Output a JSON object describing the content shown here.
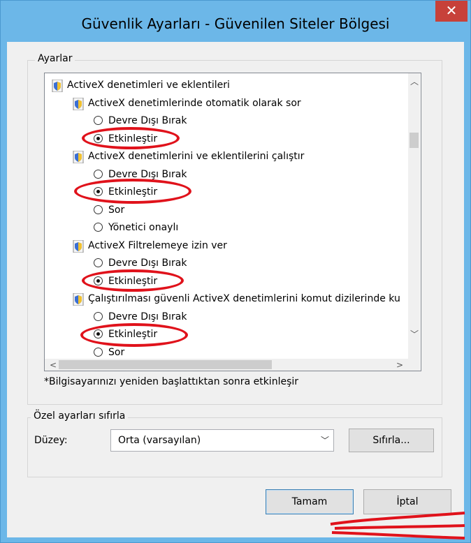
{
  "window": {
    "title": "Güvenlik Ayarları - Güvenilen Siteler Bölgesi",
    "close_glyph": "✕"
  },
  "settings_group": {
    "legend": "Ayarlar",
    "tree": [
      {
        "type": "category",
        "label": "ActiveX denetimleri ve eklentileri",
        "icon": "shield-icon"
      },
      {
        "type": "setting",
        "label": "ActiveX denetimlerinde otomatik olarak sor",
        "icon": "shield-icon"
      },
      {
        "type": "option",
        "label": "Devre Dışı Bırak",
        "checked": false
      },
      {
        "type": "option",
        "label": "Etkinleştir",
        "checked": true
      },
      {
        "type": "setting",
        "label": "ActiveX denetimlerini ve eklentilerini çalıştır",
        "icon": "shield-icon"
      },
      {
        "type": "option",
        "label": "Devre Dışı Bırak",
        "checked": false
      },
      {
        "type": "option",
        "label": "Etkinleştir",
        "checked": true
      },
      {
        "type": "option",
        "label": "Sor",
        "checked": false
      },
      {
        "type": "option",
        "label": "Yönetici onaylı",
        "checked": false
      },
      {
        "type": "setting",
        "label": "ActiveX Filtrelemeye izin ver",
        "icon": "shield-icon"
      },
      {
        "type": "option",
        "label": "Devre Dışı Bırak",
        "checked": false
      },
      {
        "type": "option",
        "label": "Etkinleştir",
        "checked": true
      },
      {
        "type": "setting",
        "label": "Çalıştırılması güvenli ActiveX denetimlerini komut dizilerinde ku",
        "icon": "shield-icon"
      },
      {
        "type": "option",
        "label": "Devre Dışı Bırak",
        "checked": false
      },
      {
        "type": "option",
        "label": "Etkinleştir",
        "checked": true
      },
      {
        "type": "option",
        "label": "Sor",
        "checked": false
      }
    ],
    "note": "*Bilgisayarınızı yeniden başlattıktan sonra etkinleşir"
  },
  "reset_group": {
    "legend": "Özel ayarları sıfırla",
    "level_label": "Düzey:",
    "level_value": "Orta (varsayılan)",
    "reset_button": "Sıfırla..."
  },
  "footer": {
    "ok_button": "Tamam",
    "cancel_button": "İptal"
  },
  "colors": {
    "titlebar": "#6cb7e8",
    "close_button": "#c7413a",
    "annotation": "#e0121b"
  }
}
